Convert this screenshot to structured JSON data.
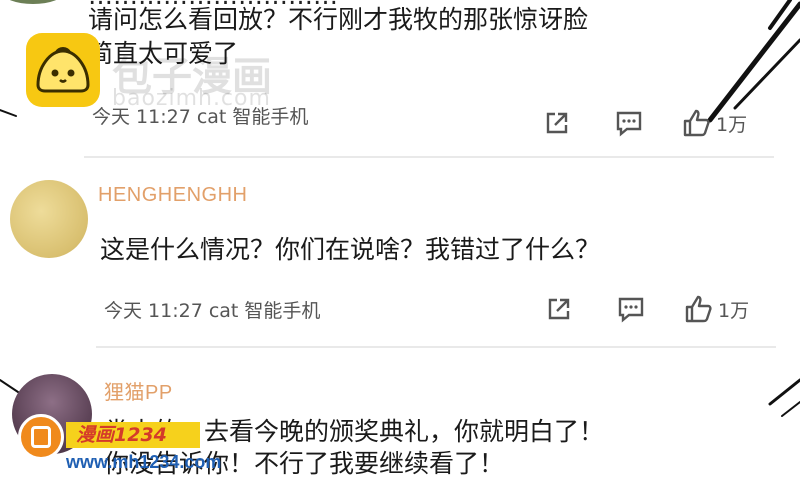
{
  "watermark": {
    "brand_cn": "包子漫画",
    "url": "baozimh.com"
  },
  "comments": [
    {
      "lines": [
        "请问怎么看回放？不行刚才我牧的那张惊讶脸",
        "简直太可爱了"
      ],
      "meta": "今天 11:27 cat 智能手机",
      "like_count": "1万"
    },
    {
      "username": "HENGHENGHH",
      "lines": [
        "这是什么情况？你们在说啥？我错过了什么？"
      ],
      "meta": "今天 11:27 cat 智能手机",
      "like_count": "1万"
    },
    {
      "username": "狸猫PP",
      "lines": [
        "粪土的，去看今晚的颁奖典礼，你就明白了！",
        "你没告诉你！不行了我要继续看了！"
      ]
    }
  ],
  "bottom_brand": {
    "title": "漫画1234",
    "url": "www.mh1234.com"
  },
  "icons": {
    "share": "share-icon",
    "comment": "comment-icon",
    "like": "thumbs-up-icon"
  }
}
